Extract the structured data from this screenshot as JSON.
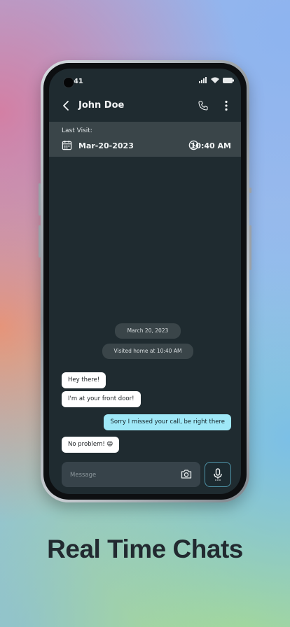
{
  "status": {
    "time": "9:41"
  },
  "header": {
    "contact_name": "John Doe"
  },
  "visit": {
    "label": "Last Visit:",
    "date": "Mar-20-2023",
    "time": "10:40 AM"
  },
  "chat": {
    "date_pill": "March 20, 2023",
    "event_pill": "Visited home at 10:40 AM",
    "messages": [
      {
        "text": "Hey there!",
        "direction": "incoming"
      },
      {
        "text": "I'm at your front door!",
        "direction": "incoming"
      },
      {
        "text": "Sorry I missed your call, be right there",
        "direction": "outgoing"
      },
      {
        "text": "No problem! 😁",
        "direction": "incoming"
      }
    ]
  },
  "composer": {
    "placeholder": "Message"
  },
  "caption": "Real Time Chats",
  "colors": {
    "screen_bg": "#1f2b30",
    "visit_bar": "#3a4549",
    "incoming_bubble": "#ffffff",
    "outgoing_bubble": "#9fe8f7",
    "accent_border": "#4f94a8"
  },
  "icons": [
    "back-arrow-icon",
    "phone-icon",
    "more-vertical-icon",
    "calendar-icon",
    "clock-icon",
    "camera-icon",
    "microphone-icon",
    "signal-icon",
    "wifi-icon",
    "battery-icon"
  ]
}
